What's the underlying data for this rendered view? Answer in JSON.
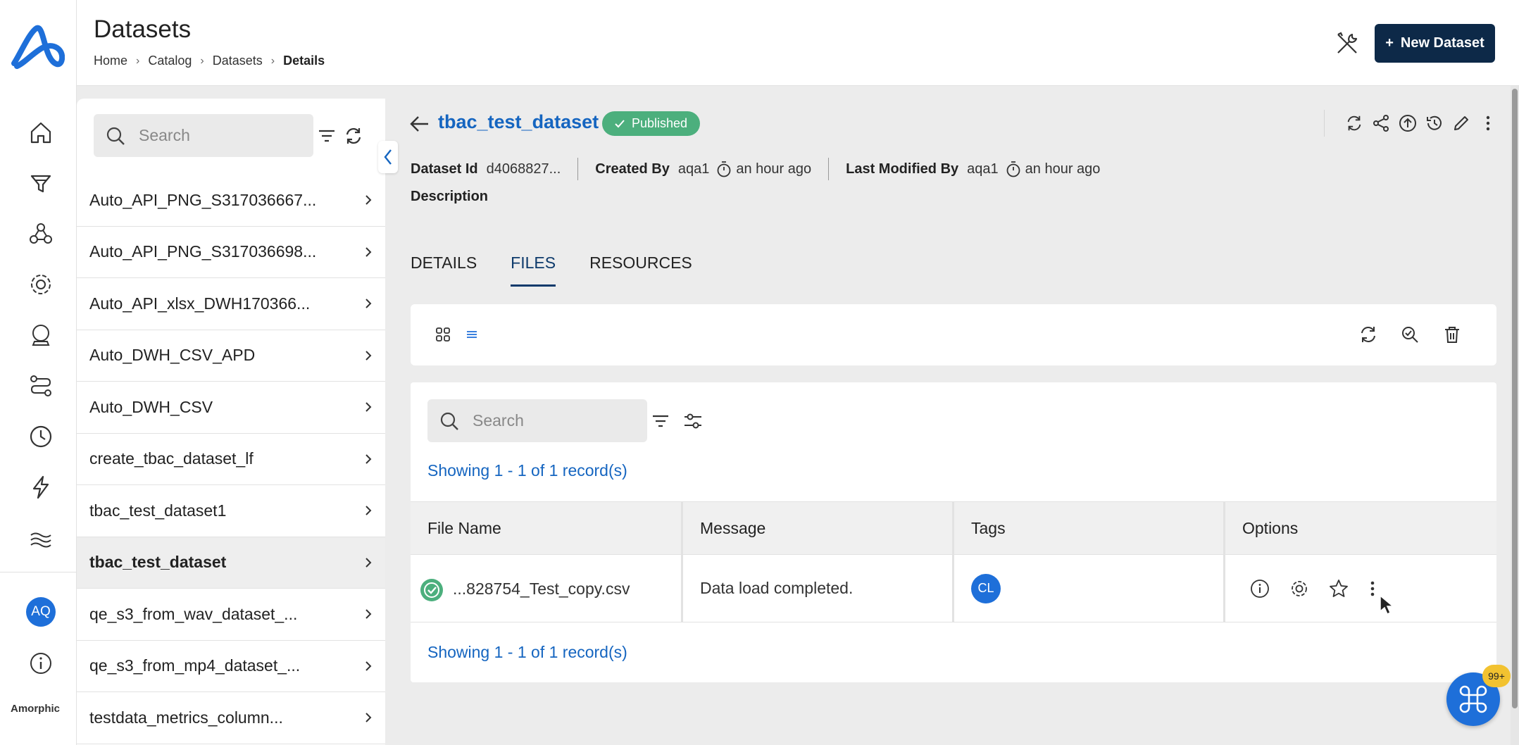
{
  "app": {
    "brand": "Amorphic",
    "user_initials": "AQ"
  },
  "header": {
    "title": "Datasets",
    "breadcrumb": [
      "Home",
      "Catalog",
      "Datasets",
      "Details"
    ],
    "new_button_label": "New Dataset"
  },
  "rail": {
    "icons": [
      "home-icon",
      "filter-funnel-icon",
      "network-nodes-icon",
      "gear-cycle-icon",
      "crystal-ball-icon",
      "workflow-icon",
      "clock-icon",
      "lightning-icon",
      "data-lake-icon",
      "info-icon"
    ]
  },
  "sidebar": {
    "search_placeholder": "Search",
    "items": [
      {
        "label": "Auto_API_PNG_S317036667..."
      },
      {
        "label": "Auto_API_PNG_S317036698..."
      },
      {
        "label": "Auto_API_xlsx_DWH170366..."
      },
      {
        "label": "Auto_DWH_CSV_APD"
      },
      {
        "label": "Auto_DWH_CSV"
      },
      {
        "label": "create_tbac_dataset_lf"
      },
      {
        "label": "tbac_test_dataset1"
      },
      {
        "label": "tbac_test_dataset",
        "active": true
      },
      {
        "label": "qe_s3_from_wav_dataset_..."
      },
      {
        "label": "qe_s3_from_mp4_dataset_..."
      },
      {
        "label": "testdata_metrics_column..."
      }
    ]
  },
  "dataset": {
    "name": "tbac_test_dataset",
    "status": "Published",
    "id_label": "Dataset Id",
    "id_value": "d4068827...",
    "created_by_label": "Created By",
    "created_by": "aqa1",
    "created_time": "an hour ago",
    "modified_by_label": "Last Modified By",
    "modified_by": "aqa1",
    "modified_time": "an hour ago",
    "description_label": "Description"
  },
  "tabs": [
    {
      "label": "DETAILS"
    },
    {
      "label": "FILES",
      "active": true
    },
    {
      "label": "RESOURCES"
    }
  ],
  "files": {
    "search_placeholder": "Search",
    "showing_top": "Showing 1 - 1 of 1 record(s)",
    "showing_bottom": "Showing 1 - 1 of 1 record(s)",
    "columns": [
      "File Name",
      "Message",
      "Tags",
      "Options"
    ],
    "rows": [
      {
        "file_name": "...828754_Test_copy.csv",
        "message": "Data load completed.",
        "tag": "CL"
      }
    ]
  },
  "fab": {
    "badge": "99+"
  },
  "colors": {
    "accent": "#1565c0",
    "primary_dark": "#0d2948",
    "published": "#4caf7d",
    "chip": "#1e6fd9",
    "badge": "#f2c230"
  }
}
